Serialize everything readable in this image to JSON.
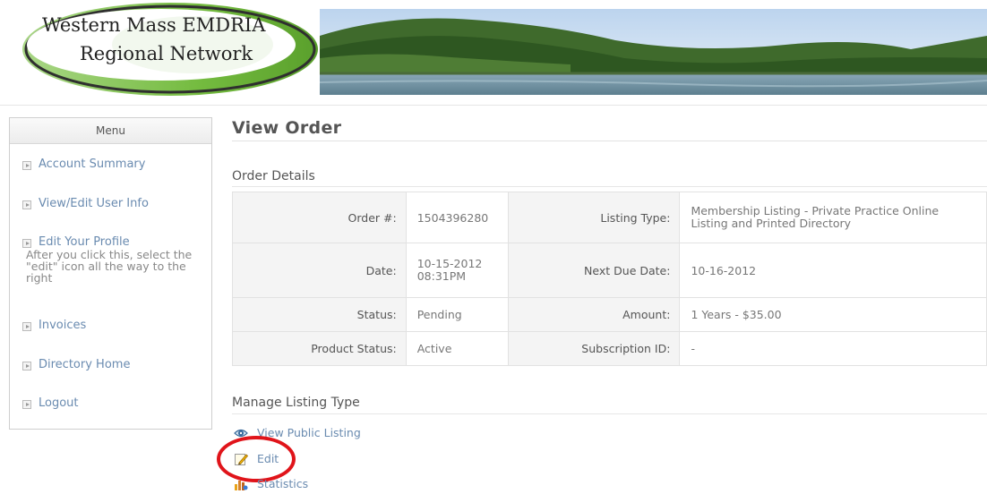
{
  "header": {
    "logo_line1": "Western Mass EMDRIA",
    "logo_line2": "Regional Network"
  },
  "sidebar": {
    "title": "Menu",
    "items": [
      {
        "label": "Account Summary"
      },
      {
        "label": "View/Edit User Info"
      },
      {
        "label": "Edit Your Profile",
        "note": "After you click this, select the \"edit\" icon all the way to the right"
      },
      {
        "label": "Invoices"
      },
      {
        "label": "Directory Home"
      },
      {
        "label": "Logout"
      }
    ]
  },
  "main": {
    "title": "View Order",
    "order_details_heading": "Order Details",
    "order": {
      "order_no_label": "Order #:",
      "order_no": "1504396280",
      "listing_type_label": "Listing Type:",
      "listing_type": "Membership Listing - Private Practice Online Listing and Printed Directory",
      "date_label": "Date:",
      "date": "10-15-2012 08:31PM",
      "next_due_label": "Next Due Date:",
      "next_due": "10-16-2012",
      "status_label": "Status:",
      "status": "Pending",
      "amount_label": "Amount:",
      "amount": "1 Years - $35.00",
      "product_status_label": "Product Status:",
      "product_status": "Active",
      "subscription_label": "Subscription ID:",
      "subscription_id": "-"
    },
    "manage_heading": "Manage Listing Type",
    "actions": [
      {
        "label": "View Public Listing",
        "icon": "eye-icon"
      },
      {
        "label": "Edit",
        "icon": "pencil-edit-icon"
      },
      {
        "label": "Statistics",
        "icon": "statistics-icon"
      }
    ]
  },
  "colors": {
    "link": "#6a8bb0",
    "highlight": "#e0141a",
    "logo_swoosh": "#7dc242"
  }
}
